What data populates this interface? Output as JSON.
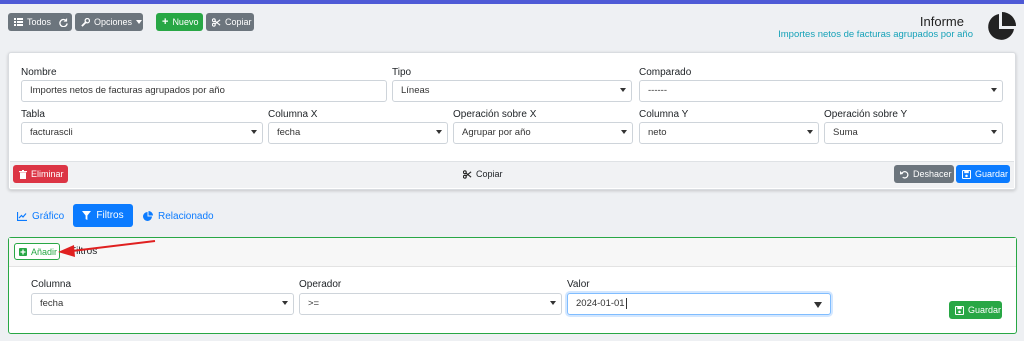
{
  "toolbar": {
    "todos_label": "Todos",
    "opciones_label": "Opciones",
    "nuevo_label": "Nuevo",
    "copiar_label": "Copiar"
  },
  "header": {
    "title": "Informe",
    "subtitle": "Importes netos de facturas agrupados por año"
  },
  "form": {
    "nombre_label": "Nombre",
    "nombre_value": "Importes netos de facturas agrupados por año",
    "tipo_label": "Tipo",
    "tipo_value": "Líneas",
    "comparado_label": "Comparado",
    "comparado_value": "------",
    "tabla_label": "Tabla",
    "tabla_value": "facturascli",
    "columnax_label": "Columna X",
    "columnax_value": "fecha",
    "opx_label": "Operación sobre X",
    "opx_value": "Agrupar por año",
    "columnay_label": "Columna Y",
    "columnay_value": "neto",
    "opy_label": "Operación sobre Y",
    "opy_value": "Suma"
  },
  "form_footer": {
    "eliminar_label": "Eliminar",
    "copiar_label": "Copiar",
    "deshacer_label": "Deshacer",
    "guardar_label": "Guardar"
  },
  "tabs": [
    {
      "label": "Gráfico"
    },
    {
      "label": "Filtros"
    },
    {
      "label": "Relacionado"
    }
  ],
  "filters": {
    "add_label": "Añadir",
    "header_title": "Filtros",
    "columna_label": "Columna",
    "columna_value": "fecha",
    "operador_label": "Operador",
    "operador_value": ">=",
    "valor_label": "Valor",
    "valor_value": "2024-01-01",
    "guardar_label": "Guardar"
  },
  "colors": {
    "accent_blue": "#0b7bff",
    "green": "#28a745",
    "red": "#dc3545",
    "teal_subtitle": "#17a2b8",
    "annotation_arrow": "#e02020"
  }
}
